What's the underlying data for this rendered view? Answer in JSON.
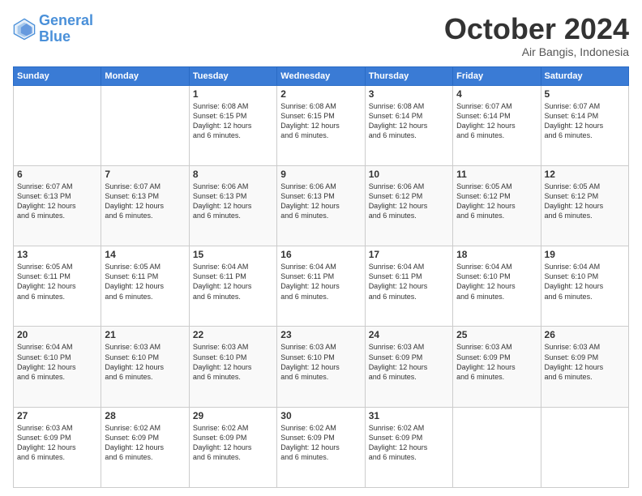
{
  "logo": {
    "line1": "General",
    "line2": "Blue"
  },
  "title": "October 2024",
  "location": "Air Bangis, Indonesia",
  "days_header": [
    "Sunday",
    "Monday",
    "Tuesday",
    "Wednesday",
    "Thursday",
    "Friday",
    "Saturday"
  ],
  "weeks": [
    [
      {
        "day": "",
        "info": ""
      },
      {
        "day": "",
        "info": ""
      },
      {
        "day": "1",
        "info": "Sunrise: 6:08 AM\nSunset: 6:15 PM\nDaylight: 12 hours\nand 6 minutes."
      },
      {
        "day": "2",
        "info": "Sunrise: 6:08 AM\nSunset: 6:15 PM\nDaylight: 12 hours\nand 6 minutes."
      },
      {
        "day": "3",
        "info": "Sunrise: 6:08 AM\nSunset: 6:14 PM\nDaylight: 12 hours\nand 6 minutes."
      },
      {
        "day": "4",
        "info": "Sunrise: 6:07 AM\nSunset: 6:14 PM\nDaylight: 12 hours\nand 6 minutes."
      },
      {
        "day": "5",
        "info": "Sunrise: 6:07 AM\nSunset: 6:14 PM\nDaylight: 12 hours\nand 6 minutes."
      }
    ],
    [
      {
        "day": "6",
        "info": "Sunrise: 6:07 AM\nSunset: 6:13 PM\nDaylight: 12 hours\nand 6 minutes."
      },
      {
        "day": "7",
        "info": "Sunrise: 6:07 AM\nSunset: 6:13 PM\nDaylight: 12 hours\nand 6 minutes."
      },
      {
        "day": "8",
        "info": "Sunrise: 6:06 AM\nSunset: 6:13 PM\nDaylight: 12 hours\nand 6 minutes."
      },
      {
        "day": "9",
        "info": "Sunrise: 6:06 AM\nSunset: 6:13 PM\nDaylight: 12 hours\nand 6 minutes."
      },
      {
        "day": "10",
        "info": "Sunrise: 6:06 AM\nSunset: 6:12 PM\nDaylight: 12 hours\nand 6 minutes."
      },
      {
        "day": "11",
        "info": "Sunrise: 6:05 AM\nSunset: 6:12 PM\nDaylight: 12 hours\nand 6 minutes."
      },
      {
        "day": "12",
        "info": "Sunrise: 6:05 AM\nSunset: 6:12 PM\nDaylight: 12 hours\nand 6 minutes."
      }
    ],
    [
      {
        "day": "13",
        "info": "Sunrise: 6:05 AM\nSunset: 6:11 PM\nDaylight: 12 hours\nand 6 minutes."
      },
      {
        "day": "14",
        "info": "Sunrise: 6:05 AM\nSunset: 6:11 PM\nDaylight: 12 hours\nand 6 minutes."
      },
      {
        "day": "15",
        "info": "Sunrise: 6:04 AM\nSunset: 6:11 PM\nDaylight: 12 hours\nand 6 minutes."
      },
      {
        "day": "16",
        "info": "Sunrise: 6:04 AM\nSunset: 6:11 PM\nDaylight: 12 hours\nand 6 minutes."
      },
      {
        "day": "17",
        "info": "Sunrise: 6:04 AM\nSunset: 6:11 PM\nDaylight: 12 hours\nand 6 minutes."
      },
      {
        "day": "18",
        "info": "Sunrise: 6:04 AM\nSunset: 6:10 PM\nDaylight: 12 hours\nand 6 minutes."
      },
      {
        "day": "19",
        "info": "Sunrise: 6:04 AM\nSunset: 6:10 PM\nDaylight: 12 hours\nand 6 minutes."
      }
    ],
    [
      {
        "day": "20",
        "info": "Sunrise: 6:04 AM\nSunset: 6:10 PM\nDaylight: 12 hours\nand 6 minutes."
      },
      {
        "day": "21",
        "info": "Sunrise: 6:03 AM\nSunset: 6:10 PM\nDaylight: 12 hours\nand 6 minutes."
      },
      {
        "day": "22",
        "info": "Sunrise: 6:03 AM\nSunset: 6:10 PM\nDaylight: 12 hours\nand 6 minutes."
      },
      {
        "day": "23",
        "info": "Sunrise: 6:03 AM\nSunset: 6:10 PM\nDaylight: 12 hours\nand 6 minutes."
      },
      {
        "day": "24",
        "info": "Sunrise: 6:03 AM\nSunset: 6:09 PM\nDaylight: 12 hours\nand 6 minutes."
      },
      {
        "day": "25",
        "info": "Sunrise: 6:03 AM\nSunset: 6:09 PM\nDaylight: 12 hours\nand 6 minutes."
      },
      {
        "day": "26",
        "info": "Sunrise: 6:03 AM\nSunset: 6:09 PM\nDaylight: 12 hours\nand 6 minutes."
      }
    ],
    [
      {
        "day": "27",
        "info": "Sunrise: 6:03 AM\nSunset: 6:09 PM\nDaylight: 12 hours\nand 6 minutes."
      },
      {
        "day": "28",
        "info": "Sunrise: 6:02 AM\nSunset: 6:09 PM\nDaylight: 12 hours\nand 6 minutes."
      },
      {
        "day": "29",
        "info": "Sunrise: 6:02 AM\nSunset: 6:09 PM\nDaylight: 12 hours\nand 6 minutes."
      },
      {
        "day": "30",
        "info": "Sunrise: 6:02 AM\nSunset: 6:09 PM\nDaylight: 12 hours\nand 6 minutes."
      },
      {
        "day": "31",
        "info": "Sunrise: 6:02 AM\nSunset: 6:09 PM\nDaylight: 12 hours\nand 6 minutes."
      },
      {
        "day": "",
        "info": ""
      },
      {
        "day": "",
        "info": ""
      }
    ]
  ]
}
